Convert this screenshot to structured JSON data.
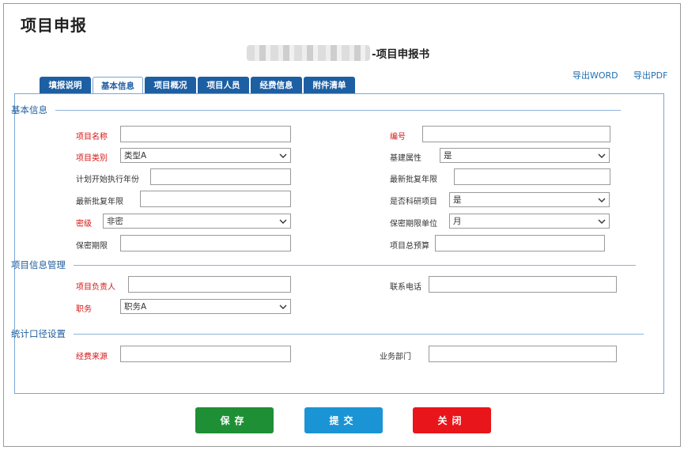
{
  "page": {
    "title": "项目申报"
  },
  "doc": {
    "title_suffix": "-项目申报书"
  },
  "exports": {
    "word": "导出WORD",
    "pdf": "导出PDF"
  },
  "tabs": [
    {
      "label": "填报说明"
    },
    {
      "label": "基本信息"
    },
    {
      "label": "项目概况"
    },
    {
      "label": "项目人员"
    },
    {
      "label": "经费信息"
    },
    {
      "label": "附件清单"
    }
  ],
  "sections": {
    "basic": "基本信息",
    "project_info": "项目信息管理",
    "stats": "统计口径设置"
  },
  "fields": {
    "project_name": {
      "label": "项目名称",
      "value": ""
    },
    "number": {
      "label": "编号",
      "value": ""
    },
    "project_type": {
      "label": "项目类别",
      "value": "类型A"
    },
    "construction_attr": {
      "label": "基建属性",
      "value": "是"
    },
    "plan_start_year": {
      "label": "计划开始执行年份",
      "value": ""
    },
    "latest_approval_left": {
      "label": "最新批复年限",
      "value": ""
    },
    "latest_approval_right": {
      "label": "最新批复年限",
      "value": ""
    },
    "is_research": {
      "label": "是否科研项目",
      "value": "是"
    },
    "secret_level": {
      "label": "密级",
      "value": "非密"
    },
    "secret_period_unit": {
      "label": "保密期限单位",
      "value": "月"
    },
    "secret_period": {
      "label": "保密期限",
      "value": ""
    },
    "total_budget": {
      "label": "项目总预算",
      "value": ""
    },
    "leader": {
      "label": "项目负责人",
      "value": ""
    },
    "phone": {
      "label": "联系电话",
      "value": ""
    },
    "position": {
      "label": "职务",
      "value": "职务A"
    },
    "funding_source": {
      "label": "经费来源",
      "value": ""
    },
    "department": {
      "label": "业务部门",
      "value": ""
    }
  },
  "buttons": {
    "save": "保存",
    "submit": "提交",
    "close": "关闭"
  },
  "colors": {
    "save": "#1e8f35",
    "submit": "#1b94d6",
    "close": "#e8151a",
    "tab": "#1d5fa3",
    "section": "#1f5d9c"
  }
}
